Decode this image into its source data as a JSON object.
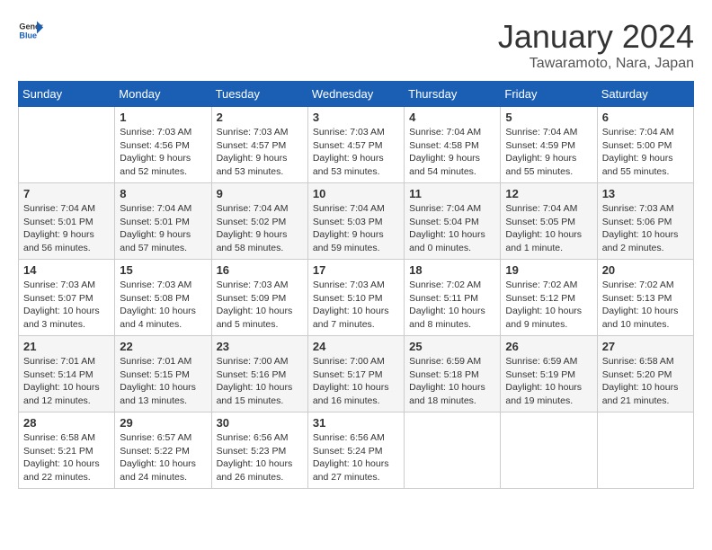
{
  "logo": {
    "brand": "General",
    "brand2": "Blue"
  },
  "header": {
    "title": "January 2024",
    "subtitle": "Tawaramoto, Nara, Japan"
  },
  "weekdays": [
    "Sunday",
    "Monday",
    "Tuesday",
    "Wednesday",
    "Thursday",
    "Friday",
    "Saturday"
  ],
  "weeks": [
    [
      {
        "day": "",
        "sunrise": "",
        "sunset": "",
        "daylight": ""
      },
      {
        "day": "1",
        "sunrise": "Sunrise: 7:03 AM",
        "sunset": "Sunset: 4:56 PM",
        "daylight": "Daylight: 9 hours and 52 minutes."
      },
      {
        "day": "2",
        "sunrise": "Sunrise: 7:03 AM",
        "sunset": "Sunset: 4:57 PM",
        "daylight": "Daylight: 9 hours and 53 minutes."
      },
      {
        "day": "3",
        "sunrise": "Sunrise: 7:03 AM",
        "sunset": "Sunset: 4:57 PM",
        "daylight": "Daylight: 9 hours and 53 minutes."
      },
      {
        "day": "4",
        "sunrise": "Sunrise: 7:04 AM",
        "sunset": "Sunset: 4:58 PM",
        "daylight": "Daylight: 9 hours and 54 minutes."
      },
      {
        "day": "5",
        "sunrise": "Sunrise: 7:04 AM",
        "sunset": "Sunset: 4:59 PM",
        "daylight": "Daylight: 9 hours and 55 minutes."
      },
      {
        "day": "6",
        "sunrise": "Sunrise: 7:04 AM",
        "sunset": "Sunset: 5:00 PM",
        "daylight": "Daylight: 9 hours and 55 minutes."
      }
    ],
    [
      {
        "day": "7",
        "sunrise": "Sunrise: 7:04 AM",
        "sunset": "Sunset: 5:01 PM",
        "daylight": "Daylight: 9 hours and 56 minutes."
      },
      {
        "day": "8",
        "sunrise": "Sunrise: 7:04 AM",
        "sunset": "Sunset: 5:01 PM",
        "daylight": "Daylight: 9 hours and 57 minutes."
      },
      {
        "day": "9",
        "sunrise": "Sunrise: 7:04 AM",
        "sunset": "Sunset: 5:02 PM",
        "daylight": "Daylight: 9 hours and 58 minutes."
      },
      {
        "day": "10",
        "sunrise": "Sunrise: 7:04 AM",
        "sunset": "Sunset: 5:03 PM",
        "daylight": "Daylight: 9 hours and 59 minutes."
      },
      {
        "day": "11",
        "sunrise": "Sunrise: 7:04 AM",
        "sunset": "Sunset: 5:04 PM",
        "daylight": "Daylight: 10 hours and 0 minutes."
      },
      {
        "day": "12",
        "sunrise": "Sunrise: 7:04 AM",
        "sunset": "Sunset: 5:05 PM",
        "daylight": "Daylight: 10 hours and 1 minute."
      },
      {
        "day": "13",
        "sunrise": "Sunrise: 7:03 AM",
        "sunset": "Sunset: 5:06 PM",
        "daylight": "Daylight: 10 hours and 2 minutes."
      }
    ],
    [
      {
        "day": "14",
        "sunrise": "Sunrise: 7:03 AM",
        "sunset": "Sunset: 5:07 PM",
        "daylight": "Daylight: 10 hours and 3 minutes."
      },
      {
        "day": "15",
        "sunrise": "Sunrise: 7:03 AM",
        "sunset": "Sunset: 5:08 PM",
        "daylight": "Daylight: 10 hours and 4 minutes."
      },
      {
        "day": "16",
        "sunrise": "Sunrise: 7:03 AM",
        "sunset": "Sunset: 5:09 PM",
        "daylight": "Daylight: 10 hours and 5 minutes."
      },
      {
        "day": "17",
        "sunrise": "Sunrise: 7:03 AM",
        "sunset": "Sunset: 5:10 PM",
        "daylight": "Daylight: 10 hours and 7 minutes."
      },
      {
        "day": "18",
        "sunrise": "Sunrise: 7:02 AM",
        "sunset": "Sunset: 5:11 PM",
        "daylight": "Daylight: 10 hours and 8 minutes."
      },
      {
        "day": "19",
        "sunrise": "Sunrise: 7:02 AM",
        "sunset": "Sunset: 5:12 PM",
        "daylight": "Daylight: 10 hours and 9 minutes."
      },
      {
        "day": "20",
        "sunrise": "Sunrise: 7:02 AM",
        "sunset": "Sunset: 5:13 PM",
        "daylight": "Daylight: 10 hours and 10 minutes."
      }
    ],
    [
      {
        "day": "21",
        "sunrise": "Sunrise: 7:01 AM",
        "sunset": "Sunset: 5:14 PM",
        "daylight": "Daylight: 10 hours and 12 minutes."
      },
      {
        "day": "22",
        "sunrise": "Sunrise: 7:01 AM",
        "sunset": "Sunset: 5:15 PM",
        "daylight": "Daylight: 10 hours and 13 minutes."
      },
      {
        "day": "23",
        "sunrise": "Sunrise: 7:00 AM",
        "sunset": "Sunset: 5:16 PM",
        "daylight": "Daylight: 10 hours and 15 minutes."
      },
      {
        "day": "24",
        "sunrise": "Sunrise: 7:00 AM",
        "sunset": "Sunset: 5:17 PM",
        "daylight": "Daylight: 10 hours and 16 minutes."
      },
      {
        "day": "25",
        "sunrise": "Sunrise: 6:59 AM",
        "sunset": "Sunset: 5:18 PM",
        "daylight": "Daylight: 10 hours and 18 minutes."
      },
      {
        "day": "26",
        "sunrise": "Sunrise: 6:59 AM",
        "sunset": "Sunset: 5:19 PM",
        "daylight": "Daylight: 10 hours and 19 minutes."
      },
      {
        "day": "27",
        "sunrise": "Sunrise: 6:58 AM",
        "sunset": "Sunset: 5:20 PM",
        "daylight": "Daylight: 10 hours and 21 minutes."
      }
    ],
    [
      {
        "day": "28",
        "sunrise": "Sunrise: 6:58 AM",
        "sunset": "Sunset: 5:21 PM",
        "daylight": "Daylight: 10 hours and 22 minutes."
      },
      {
        "day": "29",
        "sunrise": "Sunrise: 6:57 AM",
        "sunset": "Sunset: 5:22 PM",
        "daylight": "Daylight: 10 hours and 24 minutes."
      },
      {
        "day": "30",
        "sunrise": "Sunrise: 6:56 AM",
        "sunset": "Sunset: 5:23 PM",
        "daylight": "Daylight: 10 hours and 26 minutes."
      },
      {
        "day": "31",
        "sunrise": "Sunrise: 6:56 AM",
        "sunset": "Sunset: 5:24 PM",
        "daylight": "Daylight: 10 hours and 27 minutes."
      },
      {
        "day": "",
        "sunrise": "",
        "sunset": "",
        "daylight": ""
      },
      {
        "day": "",
        "sunrise": "",
        "sunset": "",
        "daylight": ""
      },
      {
        "day": "",
        "sunrise": "",
        "sunset": "",
        "daylight": ""
      }
    ]
  ]
}
